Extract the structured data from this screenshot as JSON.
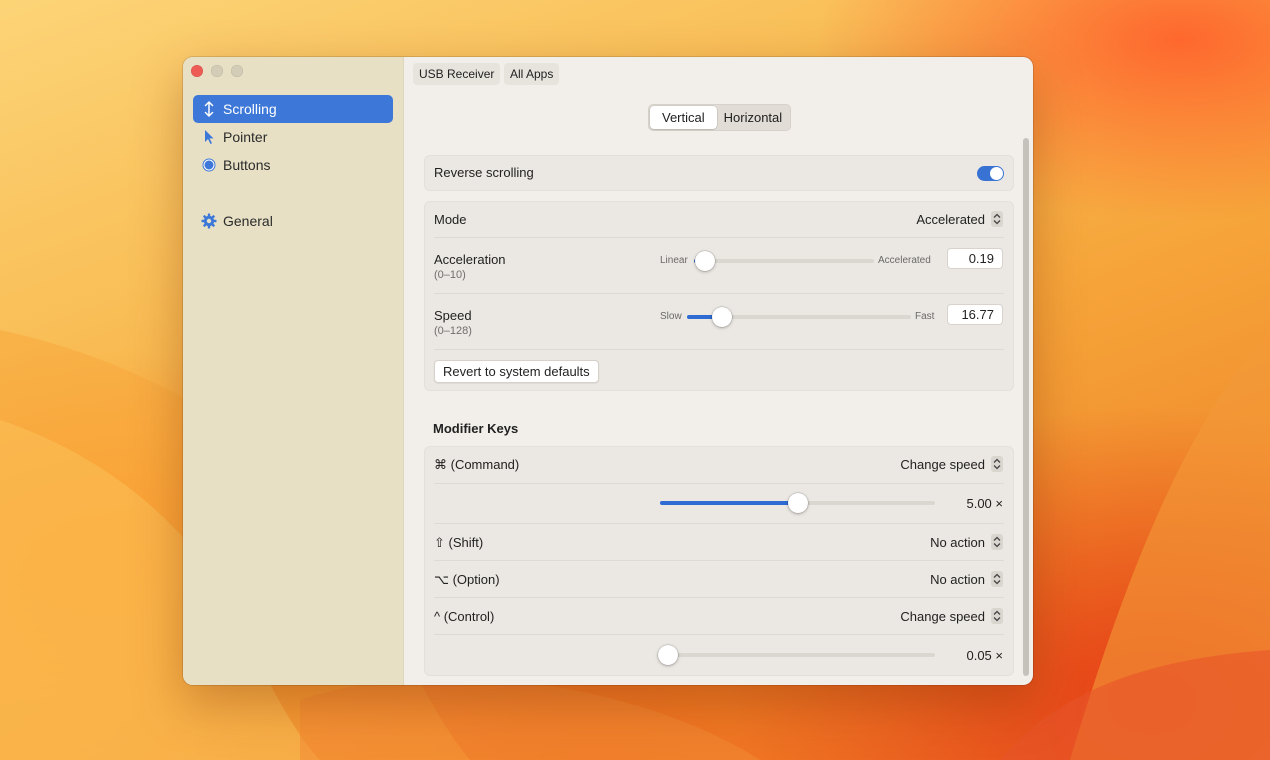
{
  "window": {
    "sidebar": {
      "items": [
        {
          "label": "Scrolling",
          "icon": "vertical-arrows-icon",
          "active": true
        },
        {
          "label": "Pointer",
          "icon": "pointer-arrow-icon",
          "active": false
        },
        {
          "label": "Buttons",
          "icon": "circle-button-icon",
          "active": false
        },
        {
          "label": "General",
          "icon": "gear-icon",
          "active": false
        }
      ]
    },
    "top_tabs": [
      "USB Receiver",
      "All Apps"
    ],
    "segment": {
      "options": [
        "Vertical",
        "Horizontal"
      ],
      "selected": "Vertical"
    },
    "reverse_scrolling": {
      "label": "Reverse scrolling",
      "on": true
    },
    "mode": {
      "label": "Mode",
      "value": "Accelerated"
    },
    "acceleration": {
      "label": "Acceleration",
      "range": "(0–10)",
      "min_label": "Linear",
      "max_label": "Accelerated",
      "value": "0.19",
      "level": 0.019
    },
    "speed": {
      "label": "Speed",
      "range": "(0–128)",
      "min_label": "Slow",
      "max_label": "Fast",
      "value": "16.77",
      "level": 0.131
    },
    "revert_button": "Revert to system defaults",
    "modifier_keys": {
      "title": "Modifier Keys",
      "command": {
        "label": "⌘ (Command)",
        "action": "Change speed",
        "value": "5.00 ×",
        "level": 0.5
      },
      "shift": {
        "label": "⇧ (Shift)",
        "action": "No action"
      },
      "option": {
        "label": "⌥ (Option)",
        "action": "No action"
      },
      "control": {
        "label": "^ (Control)",
        "action": "Change speed",
        "value": "0.05 ×",
        "level": 0.0
      }
    }
  },
  "colors": {
    "accent": "#3d78d8",
    "sidebar": "#e7e0c5",
    "close": "#ee5b55"
  }
}
